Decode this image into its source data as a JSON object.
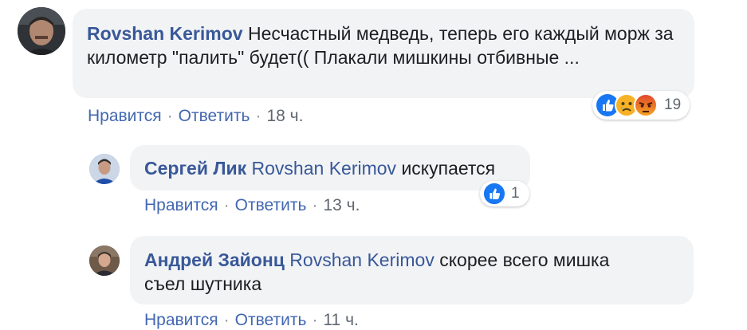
{
  "comments": [
    {
      "author": "Rovshan Kerimov",
      "text": "Несчастный медведь, теперь его каждый морж за километр \"палить\" будет(( Плакали мишкины отбивные ...",
      "like_label": "Нравится",
      "reply_label": "Ответить",
      "time": "18 ч.",
      "reactions": [
        "like-icon",
        "sad-icon",
        "angry-icon"
      ],
      "reaction_count": "19"
    },
    {
      "author": "Сергей Лик",
      "mention": "Rovshan Kerimov",
      "text": "искупается",
      "like_label": "Нравится",
      "reply_label": "Ответить",
      "time": "13 ч.",
      "reactions": [
        "like-icon"
      ],
      "reaction_count": "1"
    },
    {
      "author": "Андрей Зайонц",
      "mention": "Rovshan Kerimov",
      "text": "скорее всего мишка съел шутника",
      "like_label": "Нравится",
      "reply_label": "Ответить",
      "time": "11 ч."
    }
  ],
  "separator": "·",
  "colors": {
    "bubble": "#f2f3f5",
    "name": "#385898",
    "action_link": "#4267b2",
    "like": "#1877f2",
    "angry": "#e9710f",
    "sad": "#f7b125"
  }
}
